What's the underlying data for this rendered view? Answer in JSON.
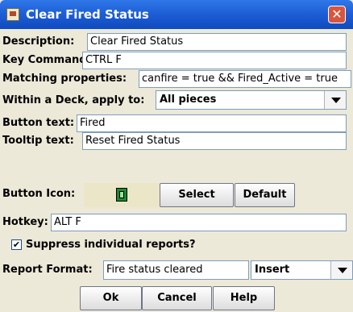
{
  "window": {
    "title": "Clear Fired Status",
    "close_glyph": "✕"
  },
  "form": {
    "description_label": "Description:",
    "description_value": "Clear Fired Status",
    "key_command_label": "Key Command:",
    "key_command_value": "CTRL F",
    "matching_label": "Matching properties:",
    "matching_value": "canfire = true && Fired_Active = true",
    "within_deck_label": "Within a Deck, apply to:",
    "within_deck_value": "All pieces",
    "button_text_label": "Button text:",
    "button_text_value": "Fired",
    "tooltip_label": "Tooltip text:",
    "tooltip_value": "Reset Fired Status",
    "button_icon_label": "Button Icon:",
    "select_label": "Select",
    "default_label": "Default",
    "hotkey_label": "Hotkey:",
    "hotkey_value": "ALT F",
    "suppress_label": "Suppress individual reports?",
    "suppress_checked": true,
    "checkmark": "✔",
    "report_format_label": "Report Format:",
    "report_format_value": "Fire status cleared",
    "insert_label": "Insert"
  },
  "buttons": {
    "ok_label": "Ok",
    "cancel_label": "Cancel",
    "help_label": "Help"
  },
  "icons": {
    "app": "app-icon",
    "close": "close-icon",
    "button_icon": "counter-chip-icon",
    "dropdown": "chevron-down-icon"
  }
}
